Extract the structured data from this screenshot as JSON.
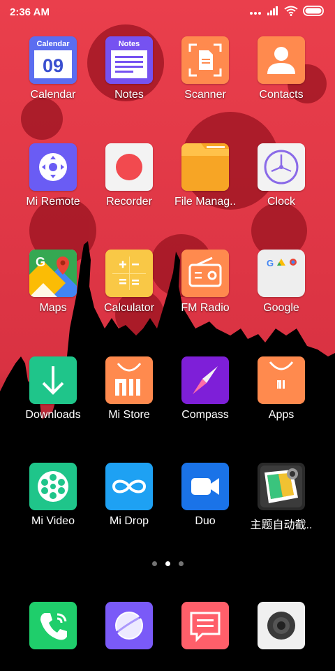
{
  "status_bar": {
    "time": "2:36 AM"
  },
  "apps": [
    {
      "label": "Calendar",
      "icon": "calendar-icon",
      "badge": "Calendar",
      "day": "09"
    },
    {
      "label": "Notes",
      "icon": "notes-icon",
      "badge": "Notes"
    },
    {
      "label": "Scanner",
      "icon": "scanner-icon"
    },
    {
      "label": "Contacts",
      "icon": "contacts-icon"
    },
    {
      "label": "Mi Remote",
      "icon": "mi-remote-icon"
    },
    {
      "label": "Recorder",
      "icon": "recorder-icon"
    },
    {
      "label": "File Manag..",
      "icon": "folder-icon"
    },
    {
      "label": "Clock",
      "icon": "clock-icon"
    },
    {
      "label": "Maps",
      "icon": "maps-icon"
    },
    {
      "label": "Calculator",
      "icon": "calculator-icon"
    },
    {
      "label": "FM Radio",
      "icon": "radio-icon"
    },
    {
      "label": "Google",
      "icon": "google-folder-icon"
    },
    {
      "label": "Downloads",
      "icon": "downloads-icon"
    },
    {
      "label": "Mi Store",
      "icon": "mi-store-icon"
    },
    {
      "label": "Compass",
      "icon": "compass-icon"
    },
    {
      "label": "Apps",
      "icon": "apps-store-icon"
    },
    {
      "label": "Mi Video",
      "icon": "mi-video-icon"
    },
    {
      "label": "Mi Drop",
      "icon": "mi-drop-icon"
    },
    {
      "label": "Duo",
      "icon": "duo-icon"
    },
    {
      "label": "主题自动截..",
      "icon": "theme-screenshot-icon"
    }
  ],
  "dock": [
    {
      "icon": "phone-icon"
    },
    {
      "icon": "browser-icon"
    },
    {
      "icon": "messaging-icon"
    },
    {
      "icon": "camera-icon"
    }
  ],
  "page_indicator": {
    "pages": 3,
    "active": 2
  },
  "colors": {
    "wallpaper_red": "#e63f4d",
    "calendar": "#5b6df0",
    "scanner": "#ff8a4e",
    "mi_remote": "#6a5cf4",
    "folder": "#f7a525",
    "downloads": "#1fc58a",
    "compass": "#7e1fd8",
    "mi_drop": "#1ea1f3",
    "duo": "#1a73e8",
    "phone": "#1fce6b",
    "browser": "#7a5af8",
    "messaging": "#ff5f6a"
  }
}
